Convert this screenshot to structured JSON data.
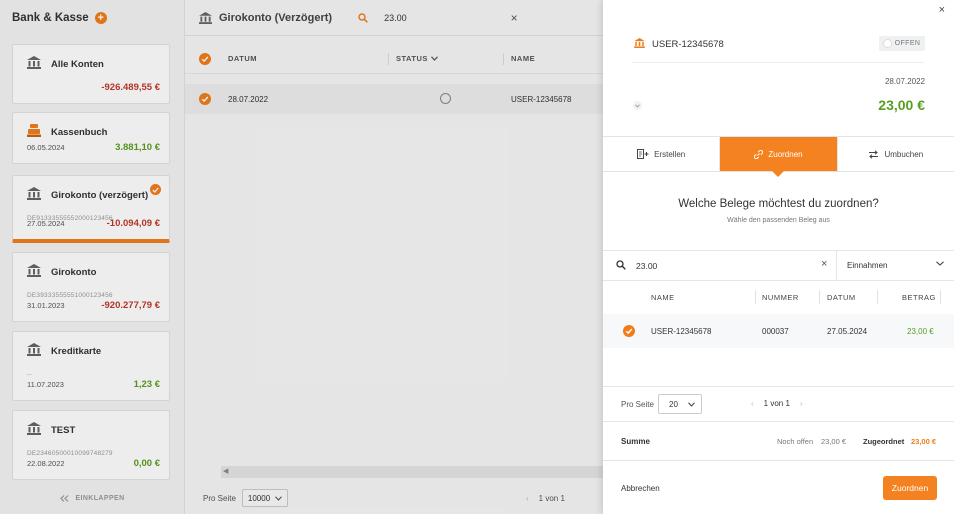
{
  "sidebar": {
    "title": "Bank & Kasse",
    "collapse_label": "EINKLAPPEN",
    "accounts": [
      {
        "name": "Alle Konten",
        "iban": "",
        "date": "",
        "amount": "-926.489,55 €"
      },
      {
        "name": "Kassenbuch",
        "iban": "",
        "date": "06.05.2024",
        "amount": "3.881,10 €"
      },
      {
        "name": "Girokonto (verzögert)",
        "iban": "DE91333555552000123456",
        "date": "27.05.2024",
        "amount": "-10.094,09 €"
      },
      {
        "name": "Girokonto",
        "iban": "DE39333555551000123456",
        "date": "31.01.2023",
        "amount": "-920.277,79 €"
      },
      {
        "name": "Kreditkarte",
        "iban": "--",
        "date": "11.07.2023",
        "amount": "1,23 €"
      },
      {
        "name": "TEST",
        "iban": "DE23460500010099748279",
        "date": "22.08.2022",
        "amount": "0,00 €"
      }
    ]
  },
  "main": {
    "account_title": "Girokonto (Verzögert)",
    "search_value": "23.00",
    "columns": {
      "date": "DATUM",
      "status": "STATUS",
      "name": "NAME"
    },
    "row": {
      "date": "28.07.2022",
      "name": "USER-12345678"
    },
    "footer": {
      "per_page_label": "Pro Seite",
      "per_page_value": "10000",
      "page_info": "1 von 1"
    }
  },
  "drawer": {
    "title": "USER-12345678",
    "status": "OFFEN",
    "date": "28.07.2022",
    "amount": "23,00 €",
    "tabs": {
      "create": "Erstellen",
      "assign": "Zuordnen",
      "rebook": "Umbuchen"
    },
    "question": "Welche Belege möchtest du zuordnen?",
    "subtitle": "Wähle den passenden Beleg aus",
    "search_value": "23.00",
    "type_filter": "Einnahmen",
    "columns": {
      "name": "NAME",
      "number": "NUMMER",
      "date": "DATUM",
      "amount": "BETRAG"
    },
    "receipt": {
      "name": "USER-12345678",
      "number": "000037",
      "date": "27.05.2024",
      "amount": "23,00 €"
    },
    "pager": {
      "per_page_label": "Pro Seite",
      "per_page_value": "20",
      "page_info": "1 von 1"
    },
    "summary": {
      "label": "Summe",
      "open_label": "Noch offen",
      "open_value": "23,00 €",
      "assigned_label": "Zugeordnet",
      "assigned_value": "23,00 €"
    },
    "cancel_label": "Abbrechen",
    "assign_label": "Zuordnen"
  },
  "colors": {
    "accent": "#f58220",
    "positive": "#5a9e20",
    "negative": "#c0392b"
  }
}
